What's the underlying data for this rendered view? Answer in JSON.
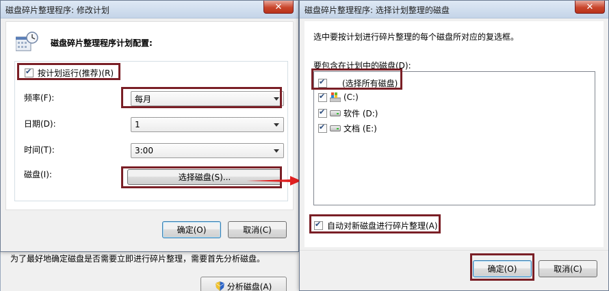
{
  "background_window": {
    "info_text": "为了最好地确定磁盘是否需要立即进行碎片整理，需要首先分析磁盘。",
    "analyze_button": "分析磁盘(A)"
  },
  "left_dialog": {
    "title": "磁盘碎片整理程序: 修改计划",
    "close": "✕",
    "heading": "磁盘碎片整理程序计划配置:",
    "run_on_schedule": "按计划运行(推荐)(R)",
    "frequency_label": "频率(F):",
    "frequency_value": "每月",
    "day_label": "日期(D):",
    "day_value": "1",
    "time_label": "时间(T):",
    "time_value": "3:00",
    "disks_label": "磁盘(I):",
    "select_disks_button": "选择磁盘(S)...",
    "ok_button": "确定(O)",
    "cancel_button": "取消(C)",
    "icon": "calendar-clock-icon"
  },
  "right_dialog": {
    "title": "磁盘碎片整理程序: 选择计划整理的磁盘",
    "close": "✕",
    "instructions": "选中要按计划进行碎片整理的每个磁盘所对应的复选框。",
    "list_label": "要包含在计划中的磁盘(D):",
    "disks": [
      {
        "label": "(选择所有磁盘)",
        "checked": true,
        "icon": "none"
      },
      {
        "label": "(C:)",
        "checked": true,
        "icon": "system-drive-icon"
      },
      {
        "label": "软件 (D:)",
        "checked": true,
        "icon": "drive-icon"
      },
      {
        "label": "文档 (E:)",
        "checked": true,
        "icon": "drive-icon"
      }
    ],
    "auto_defrag_new": "自动对新磁盘进行碎片整理(A)",
    "ok_button": "确定(O)",
    "cancel_button": "取消(C)"
  },
  "colors": {
    "highlight_box": "#7a1f26",
    "arrow": "#e02020",
    "title_bar": "#c4d4e8"
  }
}
